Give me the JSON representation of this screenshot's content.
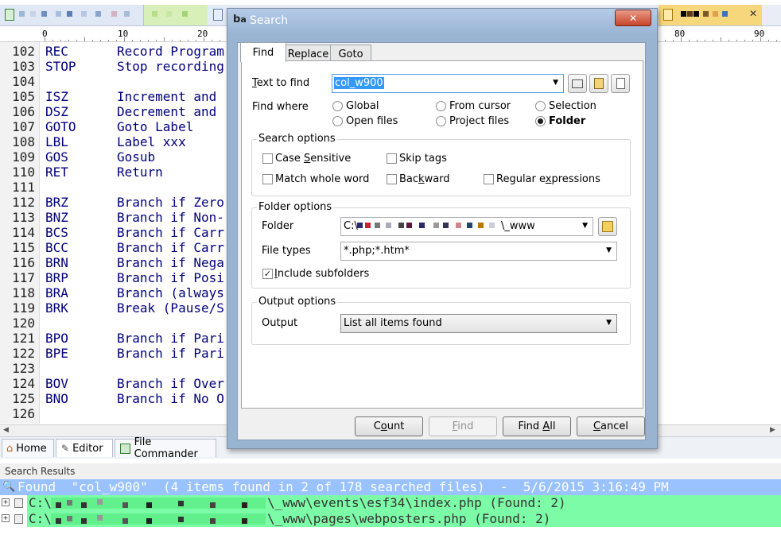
{
  "colors": {
    "dialog_frame": "#99b4d1",
    "selection": "#3399ff",
    "results_header": "#99c2ff",
    "results_row": "#7dfca7",
    "code_text": "#00007a"
  },
  "ruler": [
    "0",
    "10",
    "20",
    "80",
    "90"
  ],
  "line_numbers": [
    "102",
    "103",
    "104",
    "105",
    "106",
    "107",
    "108",
    "109",
    "110",
    "111",
    "112",
    "113",
    "114",
    "115",
    "116",
    "117",
    "118",
    "119",
    "120",
    "121",
    "122",
    "123",
    "124",
    "125",
    "126"
  ],
  "code_lines": [
    {
      "mnemonic": "REC",
      "desc": "Record Program"
    },
    {
      "mnemonic": "STOP",
      "desc": "Stop recording"
    },
    {
      "mnemonic": "",
      "desc": ""
    },
    {
      "mnemonic": "ISZ",
      "desc": "Increment and"
    },
    {
      "mnemonic": "DSZ",
      "desc": "Decrement and"
    },
    {
      "mnemonic": "GOTO",
      "desc": "Goto Label"
    },
    {
      "mnemonic": "LBL",
      "desc": "Label xxx"
    },
    {
      "mnemonic": "GOS",
      "desc": "Gosub"
    },
    {
      "mnemonic": "RET",
      "desc": "Return"
    },
    {
      "mnemonic": "",
      "desc": ""
    },
    {
      "mnemonic": "BRZ",
      "desc": "Branch if Zero"
    },
    {
      "mnemonic": "BNZ",
      "desc": "Branch if Non-"
    },
    {
      "mnemonic": "BCS",
      "desc": "Branch if Carr"
    },
    {
      "mnemonic": "BCC",
      "desc": "Branch if Carr"
    },
    {
      "mnemonic": "BRN",
      "desc": "Branch if Nega"
    },
    {
      "mnemonic": "BRP",
      "desc": "Branch if Posi"
    },
    {
      "mnemonic": "BRA",
      "desc": "Branch (always"
    },
    {
      "mnemonic": "BRK",
      "desc": "Break (Pause/S"
    },
    {
      "mnemonic": "",
      "desc": ""
    },
    {
      "mnemonic": "BPO",
      "desc": "Branch if Pari"
    },
    {
      "mnemonic": "BPE",
      "desc": "Branch if Pari"
    },
    {
      "mnemonic": "",
      "desc": ""
    },
    {
      "mnemonic": "BOV",
      "desc": "Branch if Over"
    },
    {
      "mnemonic": "BNO",
      "desc": "Branch if No O"
    },
    {
      "mnemonic": "",
      "desc": ""
    }
  ],
  "view_tabs": [
    "Home",
    "Editor",
    "File Commander"
  ],
  "search_results": {
    "title": "Search Results",
    "summary": "Found  \"col_w900\"  (4 items found in 2 of 178 searched files)  -  5/6/2015 3:16:49 PM",
    "rows": [
      {
        "prefix": "C:\\",
        "suffix": "\\_www\\events\\esf34\\index.php (Found: 2)"
      },
      {
        "prefix": "C:\\",
        "suffix": "\\_www\\pages\\webposters.php (Found: 2)"
      }
    ]
  },
  "dialog": {
    "title": "Search",
    "app_icon": "b",
    "app_icon_sub": "a",
    "close_glyph": "✕",
    "tabs": [
      "Find",
      "Replace",
      "Goto"
    ],
    "text_to_find": {
      "pre": "",
      "key": "T",
      "post": "ext to find",
      "value": "col_w900"
    },
    "find_where": {
      "label": "Find where",
      "options": [
        "Global",
        "From cursor",
        "Selection",
        "Open files",
        "Project files",
        "Folder"
      ],
      "selected": "Folder"
    },
    "search_options": {
      "title": "Search options",
      "case_sensitive": {
        "pre": "Case ",
        "key": "S",
        "post": "ensitive",
        "checked": false
      },
      "skip_tags": {
        "pre": "Skip tags",
        "key": "",
        "post": "",
        "checked": false
      },
      "match_whole_word": {
        "pre": "Match whole word",
        "key": "",
        "post": "",
        "checked": false
      },
      "backward": {
        "pre": "Bac",
        "key": "k",
        "post": "ward",
        "checked": false
      },
      "regular_expressions": {
        "pre": "Regular e",
        "key": "x",
        "post": "pressions",
        "checked": false
      }
    },
    "folder_options": {
      "title": "Folder options",
      "folder_label": "Folder",
      "folder_prefix": "C:\\",
      "folder_suffix": "\\_www",
      "file_types_label": "File types",
      "file_types": "*.php;*.htm*",
      "include_subfolders": {
        "pre": "",
        "key": "I",
        "post": "nclude subfolders",
        "checked": true
      },
      "check_glyph": "✓"
    },
    "output_options": {
      "title": "Output options",
      "output_label": "Output",
      "output_value": "List all items found"
    },
    "buttons": {
      "count": {
        "pre": "C",
        "key": "o",
        "post": "unt"
      },
      "find": {
        "pre": "",
        "key": "F",
        "post": "ind"
      },
      "find_all": {
        "pre": "Find ",
        "key": "A",
        "post": "ll"
      },
      "cancel": {
        "pre": "",
        "key": "C",
        "post": "ancel"
      }
    }
  }
}
